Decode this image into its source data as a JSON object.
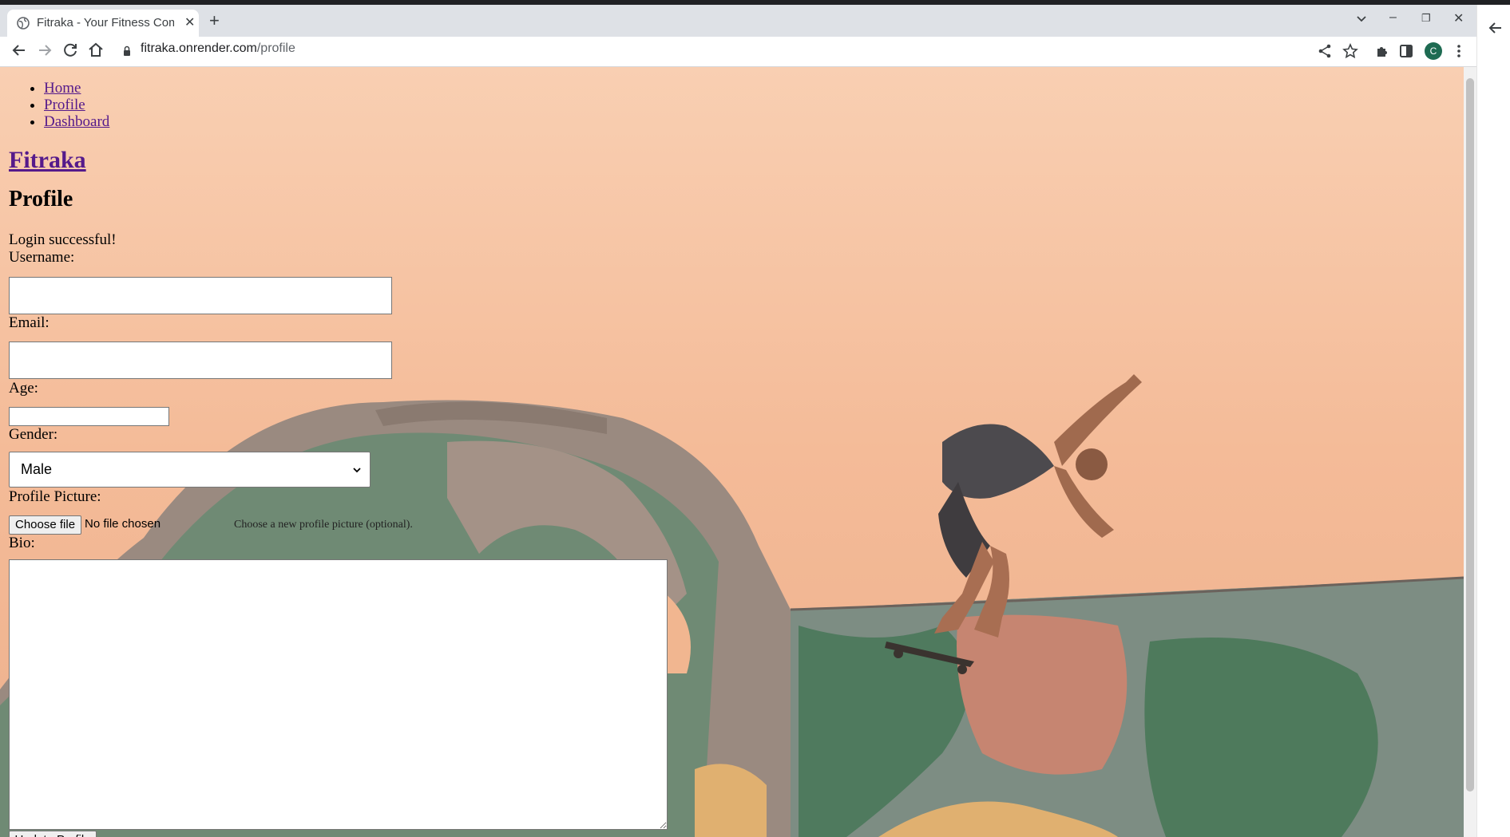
{
  "browser": {
    "tab_title": "Fitraka - Your Fitness Com",
    "url_domain": "fitraka.onrender.com",
    "url_path": "/profile",
    "profile_initial": "C"
  },
  "nav": {
    "items": [
      {
        "label": "Home"
      },
      {
        "label": "Profile"
      },
      {
        "label": "Dashboard"
      }
    ]
  },
  "site_title": "Fitraka",
  "page_heading": "Profile",
  "flash_message": "Login successful!",
  "form": {
    "username_label": "Username:",
    "username_value": "",
    "email_label": "Email:",
    "email_value": "",
    "age_label": "Age:",
    "age_value": "",
    "gender_label": "Gender:",
    "gender_selected": "Male",
    "picture_label": "Profile Picture:",
    "file_button": "Choose file",
    "file_status": "No file chosen",
    "picture_help": "Choose a new profile picture (optional).",
    "bio_label": "Bio:",
    "bio_value": "",
    "submit_label": "Update Profile"
  },
  "colors": {
    "link_visited": "#551a8b",
    "sky_top": "#f5c4a6",
    "sky_bottom": "#f2b793",
    "ramp_green": "#5d7c63",
    "ramp_terracotta": "#c27f6c"
  }
}
